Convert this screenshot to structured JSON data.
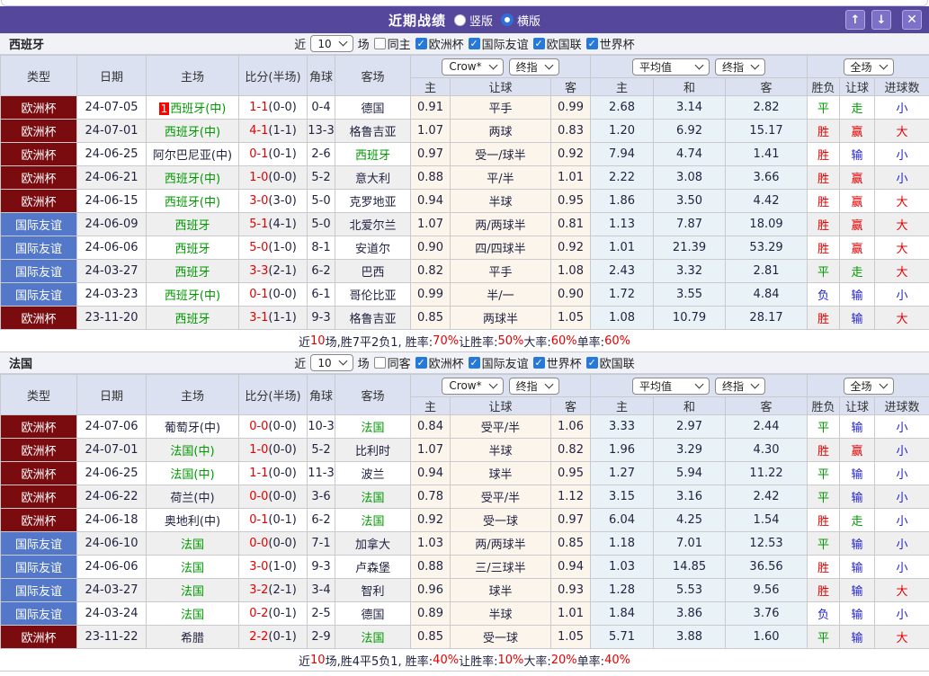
{
  "titlebar": {
    "title": "近期战绩",
    "view_options": [
      {
        "label": "竖版",
        "selected": false
      },
      {
        "label": "横版",
        "selected": true
      }
    ],
    "icons": {
      "arrow_up": "↑",
      "arrow_down": "↓",
      "close": "✕"
    }
  },
  "filter_common": {
    "near": "近",
    "games": "场"
  },
  "table_headers": {
    "type": "类型",
    "date": "日期",
    "home": "主场",
    "score": "比分(半场)",
    "corner": "角球",
    "away": "客场",
    "sub": [
      "主",
      "让球",
      "客",
      "主",
      "和",
      "客",
      "胜负",
      "让球",
      "进球数"
    ],
    "dropdowns": {
      "crow": "Crow*",
      "final1": "终指",
      "average": "平均值",
      "final2": "终指",
      "fullmatch": "全场"
    }
  },
  "colors": {
    "bar": "#55489C",
    "maroon": "#7A0C10",
    "friendly": "#5377C9",
    "red": "#E60000",
    "green": "#009900",
    "blue": "#2222CC",
    "dark": "#1F2240"
  },
  "sections": [
    {
      "team": "西班牙",
      "filter": {
        "count": "10",
        "same_label": "同主",
        "same_checked": false,
        "cups": [
          {
            "label": "欧洲杯",
            "checked": true
          },
          {
            "label": "国际友谊",
            "checked": true
          },
          {
            "label": "欧国联",
            "checked": true
          },
          {
            "label": "世界杯",
            "checked": true
          }
        ]
      },
      "rows": [
        {
          "league": "欧洲杯",
          "date": "24-07-05",
          "badge": "1",
          "home": "西班牙(中)",
          "home_color": "green",
          "score_ft": "1-1",
          "score_ht": "(0-0)",
          "corner": "0-4",
          "away": "德国",
          "away_color": "dark",
          "crow_home": "0.91",
          "handicap": "平手",
          "crow_away": "0.99",
          "avg_home": "2.68",
          "avg_draw": "3.14",
          "avg_away": "2.82",
          "result": "平",
          "result_color": "green",
          "hcp_result": "走",
          "hcp_color": "green",
          "goals": "小",
          "goals_color": "blue"
        },
        {
          "league": "欧洲杯",
          "date": "24-07-01",
          "badge": "",
          "home": "西班牙(中)",
          "home_color": "green",
          "score_ft": "4-1",
          "score_ht": "(1-1)",
          "corner": "13-3",
          "away": "格鲁吉亚",
          "away_color": "dark",
          "crow_home": "1.07",
          "handicap": "两球",
          "crow_away": "0.83",
          "avg_home": "1.20",
          "avg_draw": "6.92",
          "avg_away": "15.17",
          "result": "胜",
          "result_color": "red",
          "hcp_result": "赢",
          "hcp_color": "red",
          "goals": "大",
          "goals_color": "red"
        },
        {
          "league": "欧洲杯",
          "date": "24-06-25",
          "badge": "",
          "home": "阿尔巴尼亚(中)",
          "home_color": "dark",
          "score_ft": "0-1",
          "score_ht": "(0-1)",
          "corner": "2-6",
          "away": "西班牙",
          "away_color": "green",
          "crow_home": "0.97",
          "handicap": "受一/球半",
          "crow_away": "0.92",
          "avg_home": "7.94",
          "avg_draw": "4.74",
          "avg_away": "1.41",
          "result": "胜",
          "result_color": "red",
          "hcp_result": "输",
          "hcp_color": "blue",
          "goals": "小",
          "goals_color": "blue"
        },
        {
          "league": "欧洲杯",
          "date": "24-06-21",
          "badge": "",
          "home": "西班牙(中)",
          "home_color": "green",
          "score_ft": "1-0",
          "score_ht": "(0-0)",
          "corner": "5-2",
          "away": "意大利",
          "away_color": "dark",
          "crow_home": "0.88",
          "handicap": "平/半",
          "crow_away": "1.01",
          "avg_home": "2.22",
          "avg_draw": "3.08",
          "avg_away": "3.66",
          "result": "胜",
          "result_color": "red",
          "hcp_result": "赢",
          "hcp_color": "red",
          "goals": "小",
          "goals_color": "blue"
        },
        {
          "league": "欧洲杯",
          "date": "24-06-15",
          "badge": "",
          "home": "西班牙(中)",
          "home_color": "green",
          "score_ft": "3-0",
          "score_ht": "(3-0)",
          "corner": "5-0",
          "away": "克罗地亚",
          "away_color": "dark",
          "crow_home": "0.94",
          "handicap": "半球",
          "crow_away": "0.95",
          "avg_home": "1.86",
          "avg_draw": "3.50",
          "avg_away": "4.42",
          "result": "胜",
          "result_color": "red",
          "hcp_result": "赢",
          "hcp_color": "red",
          "goals": "大",
          "goals_color": "red"
        },
        {
          "league": "国际友谊",
          "date": "24-06-09",
          "badge": "",
          "home": "西班牙",
          "home_color": "green",
          "score_ft": "5-1",
          "score_ht": "(4-1)",
          "corner": "5-0",
          "away": "北爱尔兰",
          "away_color": "dark",
          "crow_home": "1.07",
          "handicap": "两/两球半",
          "crow_away": "0.81",
          "avg_home": "1.13",
          "avg_draw": "7.87",
          "avg_away": "18.09",
          "result": "胜",
          "result_color": "red",
          "hcp_result": "赢",
          "hcp_color": "red",
          "goals": "大",
          "goals_color": "red"
        },
        {
          "league": "国际友谊",
          "date": "24-06-06",
          "badge": "",
          "home": "西班牙",
          "home_color": "green",
          "score_ft": "5-0",
          "score_ht": "(1-0)",
          "corner": "8-1",
          "away": "安道尔",
          "away_color": "dark",
          "crow_home": "0.90",
          "handicap": "四/四球半",
          "crow_away": "0.92",
          "avg_home": "1.01",
          "avg_draw": "21.39",
          "avg_away": "53.29",
          "result": "胜",
          "result_color": "red",
          "hcp_result": "赢",
          "hcp_color": "red",
          "goals": "大",
          "goals_color": "red"
        },
        {
          "league": "国际友谊",
          "date": "24-03-27",
          "badge": "",
          "home": "西班牙",
          "home_color": "green",
          "score_ft": "3-3",
          "score_ht": "(2-1)",
          "corner": "6-2",
          "away": "巴西",
          "away_color": "dark",
          "crow_home": "0.82",
          "handicap": "平手",
          "crow_away": "1.08",
          "avg_home": "2.43",
          "avg_draw": "3.32",
          "avg_away": "2.81",
          "result": "平",
          "result_color": "green",
          "hcp_result": "走",
          "hcp_color": "green",
          "goals": "大",
          "goals_color": "red"
        },
        {
          "league": "国际友谊",
          "date": "24-03-23",
          "badge": "",
          "home": "西班牙(中)",
          "home_color": "green",
          "score_ft": "0-1",
          "score_ht": "(0-0)",
          "corner": "6-1",
          "away": "哥伦比亚",
          "away_color": "dark",
          "crow_home": "0.99",
          "handicap": "半/一",
          "crow_away": "0.90",
          "avg_home": "1.72",
          "avg_draw": "3.55",
          "avg_away": "4.84",
          "result": "负",
          "result_color": "blue",
          "hcp_result": "输",
          "hcp_color": "blue",
          "goals": "小",
          "goals_color": "blue"
        },
        {
          "league": "欧洲杯",
          "date": "23-11-20",
          "badge": "",
          "home": "西班牙",
          "home_color": "green",
          "score_ft": "3-1",
          "score_ht": "(1-1)",
          "corner": "9-3",
          "away": "格鲁吉亚",
          "away_color": "dark",
          "crow_home": "0.85",
          "handicap": "两球半",
          "crow_away": "1.05",
          "avg_home": "1.08",
          "avg_draw": "10.79",
          "avg_away": "28.17",
          "result": "胜",
          "result_color": "red",
          "hcp_result": "输",
          "hcp_color": "blue",
          "goals": "大",
          "goals_color": "red"
        }
      ],
      "summary": [
        {
          "text": "近",
          "color": "dark"
        },
        {
          "text": "10",
          "color": "red"
        },
        {
          "text": "场,胜7平2负1, 胜率:",
          "color": "dark"
        },
        {
          "text": "70%",
          "color": "red"
        },
        {
          "text": " 让胜率:",
          "color": "dark"
        },
        {
          "text": "50%",
          "color": "red"
        },
        {
          "text": " 大率:",
          "color": "dark"
        },
        {
          "text": "60%",
          "color": "red"
        },
        {
          "text": " 单率:",
          "color": "dark"
        },
        {
          "text": "60%",
          "color": "red"
        }
      ]
    },
    {
      "team": "法国",
      "filter": {
        "count": "10",
        "same_label": "同客",
        "same_checked": false,
        "cups": [
          {
            "label": "欧洲杯",
            "checked": true
          },
          {
            "label": "国际友谊",
            "checked": true
          },
          {
            "label": "世界杯",
            "checked": true
          },
          {
            "label": "欧国联",
            "checked": true
          }
        ]
      },
      "rows": [
        {
          "league": "欧洲杯",
          "date": "24-07-06",
          "badge": "",
          "home": "葡萄牙(中)",
          "home_color": "dark",
          "score_ft": "0-0",
          "score_ht": "(0-0)",
          "corner": "10-3",
          "away": "法国",
          "away_color": "green",
          "crow_home": "0.84",
          "handicap": "受平/半",
          "crow_away": "1.06",
          "avg_home": "3.33",
          "avg_draw": "2.97",
          "avg_away": "2.44",
          "result": "平",
          "result_color": "green",
          "hcp_result": "输",
          "hcp_color": "blue",
          "goals": "小",
          "goals_color": "blue"
        },
        {
          "league": "欧洲杯",
          "date": "24-07-01",
          "badge": "",
          "home": "法国(中)",
          "home_color": "green",
          "score_ft": "1-0",
          "score_ht": "(0-0)",
          "corner": "5-2",
          "away": "比利时",
          "away_color": "dark",
          "crow_home": "1.07",
          "handicap": "半球",
          "crow_away": "0.82",
          "avg_home": "1.96",
          "avg_draw": "3.29",
          "avg_away": "4.30",
          "result": "胜",
          "result_color": "red",
          "hcp_result": "赢",
          "hcp_color": "red",
          "goals": "小",
          "goals_color": "blue"
        },
        {
          "league": "欧洲杯",
          "date": "24-06-25",
          "badge": "",
          "home": "法国(中)",
          "home_color": "green",
          "score_ft": "1-1",
          "score_ht": "(0-0)",
          "corner": "11-3",
          "away": "波兰",
          "away_color": "dark",
          "crow_home": "0.94",
          "handicap": "球半",
          "crow_away": "0.95",
          "avg_home": "1.27",
          "avg_draw": "5.94",
          "avg_away": "11.22",
          "result": "平",
          "result_color": "green",
          "hcp_result": "输",
          "hcp_color": "blue",
          "goals": "小",
          "goals_color": "blue"
        },
        {
          "league": "欧洲杯",
          "date": "24-06-22",
          "badge": "",
          "home": "荷兰(中)",
          "home_color": "dark",
          "score_ft": "0-0",
          "score_ht": "(0-0)",
          "corner": "3-6",
          "away": "法国",
          "away_color": "green",
          "crow_home": "0.78",
          "handicap": "受平/半",
          "crow_away": "1.12",
          "avg_home": "3.15",
          "avg_draw": "3.16",
          "avg_away": "2.42",
          "result": "平",
          "result_color": "green",
          "hcp_result": "输",
          "hcp_color": "blue",
          "goals": "小",
          "goals_color": "blue"
        },
        {
          "league": "欧洲杯",
          "date": "24-06-18",
          "badge": "",
          "home": "奥地利(中)",
          "home_color": "dark",
          "score_ft": "0-1",
          "score_ht": "(0-1)",
          "corner": "6-2",
          "away": "法国",
          "away_color": "green",
          "crow_home": "0.92",
          "handicap": "受一球",
          "crow_away": "0.97",
          "avg_home": "6.04",
          "avg_draw": "4.25",
          "avg_away": "1.54",
          "result": "胜",
          "result_color": "red",
          "hcp_result": "走",
          "hcp_color": "green",
          "goals": "小",
          "goals_color": "blue"
        },
        {
          "league": "国际友谊",
          "date": "24-06-10",
          "badge": "",
          "home": "法国",
          "home_color": "green",
          "score_ft": "0-0",
          "score_ht": "(0-0)",
          "corner": "7-1",
          "away": "加拿大",
          "away_color": "dark",
          "crow_home": "1.03",
          "handicap": "两/两球半",
          "crow_away": "0.85",
          "avg_home": "1.18",
          "avg_draw": "7.01",
          "avg_away": "12.53",
          "result": "平",
          "result_color": "green",
          "hcp_result": "输",
          "hcp_color": "blue",
          "goals": "小",
          "goals_color": "blue"
        },
        {
          "league": "国际友谊",
          "date": "24-06-06",
          "badge": "",
          "home": "法国",
          "home_color": "green",
          "score_ft": "3-0",
          "score_ht": "(1-0)",
          "corner": "9-3",
          "away": "卢森堡",
          "away_color": "dark",
          "crow_home": "0.88",
          "handicap": "三/三球半",
          "crow_away": "0.94",
          "avg_home": "1.03",
          "avg_draw": "14.85",
          "avg_away": "36.56",
          "result": "胜",
          "result_color": "red",
          "hcp_result": "输",
          "hcp_color": "blue",
          "goals": "小",
          "goals_color": "blue"
        },
        {
          "league": "国际友谊",
          "date": "24-03-27",
          "badge": "",
          "home": "法国",
          "home_color": "green",
          "score_ft": "3-2",
          "score_ht": "(2-1)",
          "corner": "3-4",
          "away": "智利",
          "away_color": "dark",
          "crow_home": "0.96",
          "handicap": "球半",
          "crow_away": "0.93",
          "avg_home": "1.28",
          "avg_draw": "5.53",
          "avg_away": "9.56",
          "result": "胜",
          "result_color": "red",
          "hcp_result": "输",
          "hcp_color": "blue",
          "goals": "大",
          "goals_color": "red"
        },
        {
          "league": "国际友谊",
          "date": "24-03-24",
          "badge": "",
          "home": "法国",
          "home_color": "green",
          "score_ft": "0-2",
          "score_ht": "(0-1)",
          "corner": "2-5",
          "away": "德国",
          "away_color": "dark",
          "crow_home": "0.89",
          "handicap": "半球",
          "crow_away": "1.01",
          "avg_home": "1.84",
          "avg_draw": "3.86",
          "avg_away": "3.76",
          "result": "负",
          "result_color": "blue",
          "hcp_result": "输",
          "hcp_color": "blue",
          "goals": "小",
          "goals_color": "blue"
        },
        {
          "league": "欧洲杯",
          "date": "23-11-22",
          "badge": "",
          "home": "希腊",
          "home_color": "dark",
          "score_ft": "2-2",
          "score_ht": "(0-1)",
          "corner": "2-9",
          "away": "法国",
          "away_color": "green",
          "crow_home": "0.85",
          "handicap": "受一球",
          "crow_away": "1.05",
          "avg_home": "5.71",
          "avg_draw": "3.88",
          "avg_away": "1.60",
          "result": "平",
          "result_color": "green",
          "hcp_result": "输",
          "hcp_color": "blue",
          "goals": "大",
          "goals_color": "red"
        }
      ],
      "summary": [
        {
          "text": "近",
          "color": "dark"
        },
        {
          "text": "10",
          "color": "red"
        },
        {
          "text": "场,胜4平5负1, 胜率:",
          "color": "dark"
        },
        {
          "text": "40%",
          "color": "red"
        },
        {
          "text": " 让胜率:",
          "color": "dark"
        },
        {
          "text": "10%",
          "color": "red"
        },
        {
          "text": " 大率:",
          "color": "dark"
        },
        {
          "text": "20%",
          "color": "red"
        },
        {
          "text": " 单率:",
          "color": "dark"
        },
        {
          "text": "40%",
          "color": "red"
        }
      ]
    }
  ]
}
